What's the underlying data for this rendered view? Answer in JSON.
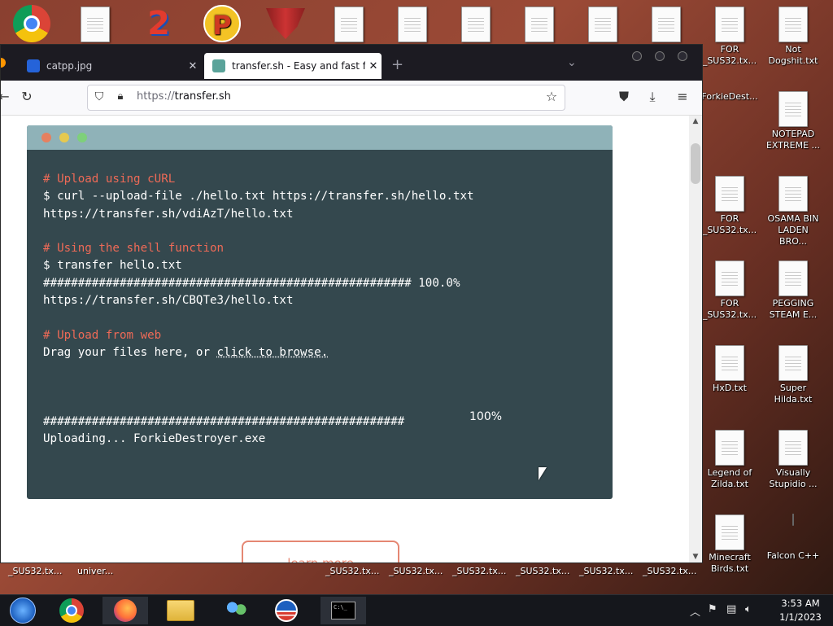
{
  "desktop": {
    "top_row_icons": [
      "chrome-icon",
      "text-file-icon",
      "number-2-icon",
      "p-icon",
      "redwing-icon",
      "text-file-icon",
      "text-file-icon",
      "text-file-icon",
      "text-file-icon",
      "text-file-icon",
      "text-file-icon"
    ],
    "right_icons": [
      {
        "label": "FOR _SUS32.tx...",
        "icon": "text-file-icon"
      },
      {
        "label": "Not Dogshit.txt",
        "icon": "text-file-icon"
      },
      {
        "label": "ForkieDest...",
        "icon": "exe-gear-icon"
      },
      {
        "label": "NOTEPAD EXTREME ...",
        "icon": "text-file-icon"
      },
      {
        "label": "FOR _SUS32.tx...",
        "icon": "text-file-icon"
      },
      {
        "label": "OSAMA BIN LADEN BRO...",
        "icon": "text-file-icon"
      },
      {
        "label": "FOR _SUS32.tx...",
        "icon": "text-file-icon"
      },
      {
        "label": "PEGGING STEAM E...",
        "icon": "text-file-icon"
      },
      {
        "label": "HxD.txt",
        "icon": "text-file-icon"
      },
      {
        "label": "Super Hilda.txt",
        "icon": "text-file-icon"
      },
      {
        "label": "Legend of Zilda.txt",
        "icon": "text-file-icon"
      },
      {
        "label": "Visually Stupidio ...",
        "icon": "text-file-icon"
      },
      {
        "label": "Minecraft Birds.txt",
        "icon": "text-file-icon"
      },
      {
        "label": "Falcon C++",
        "icon": "recycle-bin-icon"
      }
    ],
    "bottom_stub_labels": [
      "_SUS32.tx...",
      "univer...",
      "_SUS32.tx...",
      "_SUS32.tx...",
      "_SUS32.tx...",
      "_SUS32.tx...",
      "_SUS32.tx...",
      "_SUS32.tx..."
    ]
  },
  "browser": {
    "tabs": [
      {
        "title": "catpp.jpg",
        "active": false
      },
      {
        "title": "transfer.sh - Easy and fast file",
        "active": true
      }
    ],
    "url_prefix": "https://",
    "url_host": "transfer.sh",
    "terminal": {
      "lines": [
        {
          "text": "# Upload using cURL",
          "kind": "comment"
        },
        {
          "text": "$ curl --upload-file ./hello.txt https://transfer.sh/hello.txt",
          "kind": "normal"
        },
        {
          "text": "https://transfer.sh/vdiAzT/hello.txt",
          "kind": "normal"
        },
        {
          "text": "",
          "kind": "normal"
        },
        {
          "text": "# Using the shell function",
          "kind": "comment"
        },
        {
          "text": "$ transfer hello.txt",
          "kind": "normal"
        },
        {
          "text": "##################################################### 100.0%",
          "kind": "normal"
        },
        {
          "text": "https://transfer.sh/CBQTe3/hello.txt",
          "kind": "normal"
        },
        {
          "text": "",
          "kind": "normal"
        },
        {
          "text": "# Upload from web",
          "kind": "comment"
        }
      ],
      "drag_text": "Drag your files here, or ",
      "browse_link": "click to browse.",
      "progress_percent": "100%",
      "progress_hashes": "####################################################",
      "uploading_text": "Uploading... ForkieDestroyer.exe"
    },
    "learn_more": "learn more"
  },
  "taskbar": {
    "apps": [
      "start-orb-icon",
      "chrome-icon",
      "firefox-icon",
      "file-explorer-icon",
      "people-icon",
      "obama-logo-icon",
      "command-prompt-icon"
    ],
    "time": "3:53 AM",
    "date": "1/1/2023"
  }
}
